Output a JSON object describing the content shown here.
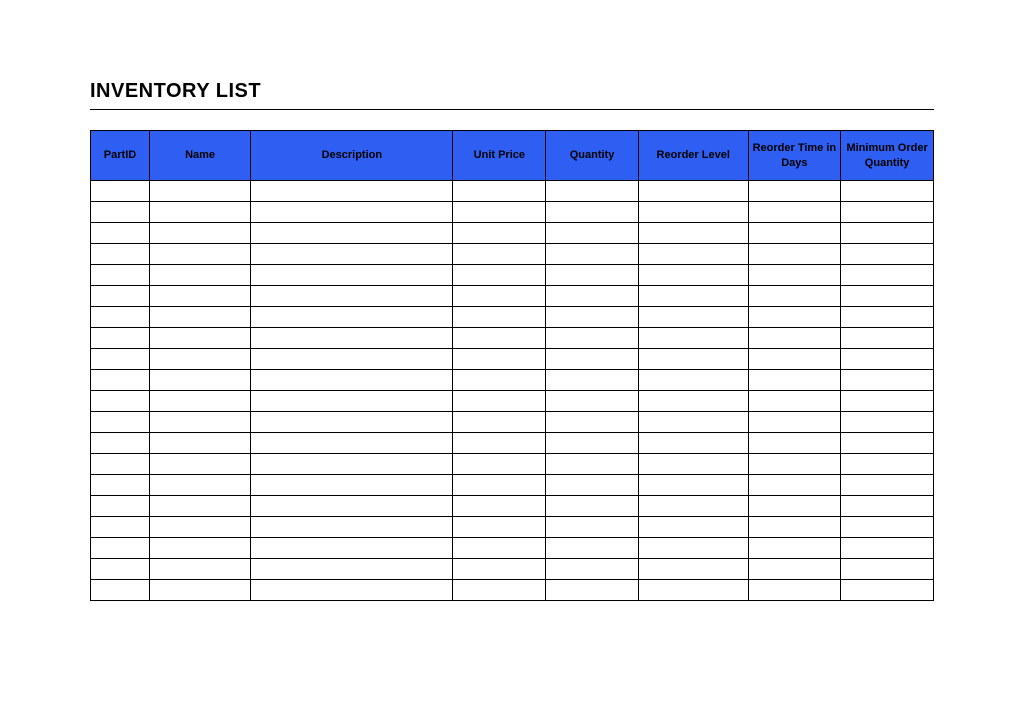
{
  "title": "INVENTORY LIST",
  "table": {
    "headers": [
      "PartID",
      "Name",
      "Description",
      "Unit Price",
      "Quantity",
      "Reorder Level",
      "Reorder Time in Days",
      "Minimum Order Quantity"
    ],
    "rows": [
      [
        "",
        "",
        "",
        "",
        "",
        "",
        "",
        ""
      ],
      [
        "",
        "",
        "",
        "",
        "",
        "",
        "",
        ""
      ],
      [
        "",
        "",
        "",
        "",
        "",
        "",
        "",
        ""
      ],
      [
        "",
        "",
        "",
        "",
        "",
        "",
        "",
        ""
      ],
      [
        "",
        "",
        "",
        "",
        "",
        "",
        "",
        ""
      ],
      [
        "",
        "",
        "",
        "",
        "",
        "",
        "",
        ""
      ],
      [
        "",
        "",
        "",
        "",
        "",
        "",
        "",
        ""
      ],
      [
        "",
        "",
        "",
        "",
        "",
        "",
        "",
        ""
      ],
      [
        "",
        "",
        "",
        "",
        "",
        "",
        "",
        ""
      ],
      [
        "",
        "",
        "",
        "",
        "",
        "",
        "",
        ""
      ],
      [
        "",
        "",
        "",
        "",
        "",
        "",
        "",
        ""
      ],
      [
        "",
        "",
        "",
        "",
        "",
        "",
        "",
        ""
      ],
      [
        "",
        "",
        "",
        "",
        "",
        "",
        "",
        ""
      ],
      [
        "",
        "",
        "",
        "",
        "",
        "",
        "",
        ""
      ],
      [
        "",
        "",
        "",
        "",
        "",
        "",
        "",
        ""
      ],
      [
        "",
        "",
        "",
        "",
        "",
        "",
        "",
        ""
      ],
      [
        "",
        "",
        "",
        "",
        "",
        "",
        "",
        ""
      ],
      [
        "",
        "",
        "",
        "",
        "",
        "",
        "",
        ""
      ],
      [
        "",
        "",
        "",
        "",
        "",
        "",
        "",
        ""
      ],
      [
        "",
        "",
        "",
        "",
        "",
        "",
        "",
        ""
      ]
    ]
  }
}
